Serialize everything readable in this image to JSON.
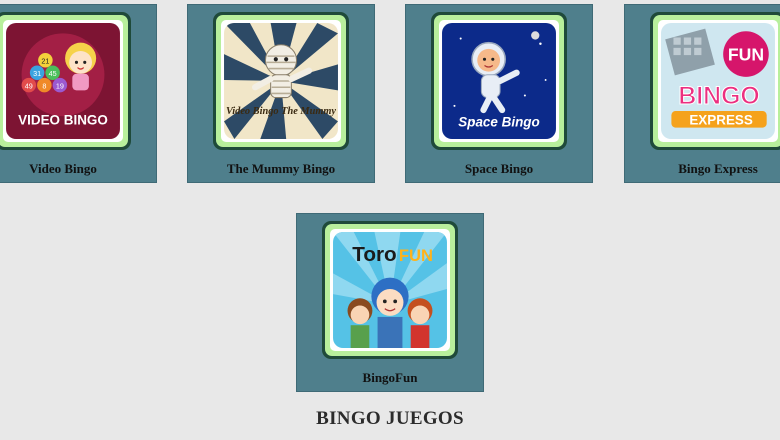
{
  "games": [
    {
      "title": "Video Bingo",
      "art_text": "VIDEO BINGO",
      "balls": [
        "21",
        "31",
        "45",
        "49",
        "8",
        "19"
      ],
      "colors": {
        "bg": "#7d1433",
        "accent": "#f5d640"
      }
    },
    {
      "title": "The Mummy Bingo",
      "art_text": "Video Bingo The Mummy",
      "colors": {
        "bg": "#2d4a66",
        "accent": "#f2e0b0"
      }
    },
    {
      "title": "Space Bingo",
      "art_text": "Space Bingo",
      "colors": {
        "bg": "#0c2a8a",
        "accent": "#ffffff"
      }
    },
    {
      "title": "Bingo Express",
      "art_text": "BINGO",
      "art_badge": "FUN",
      "art_sub": "EXPRESS",
      "colors": {
        "bg": "#cfe7f0",
        "accent": "#d6156b"
      }
    },
    {
      "title": "BingoFun",
      "art_text": "Toro",
      "art_text2": "FUN",
      "colors": {
        "bg": "#55c2e6",
        "accent": "#ffb21a"
      }
    }
  ],
  "section_title": "BINGO JUEGOS"
}
